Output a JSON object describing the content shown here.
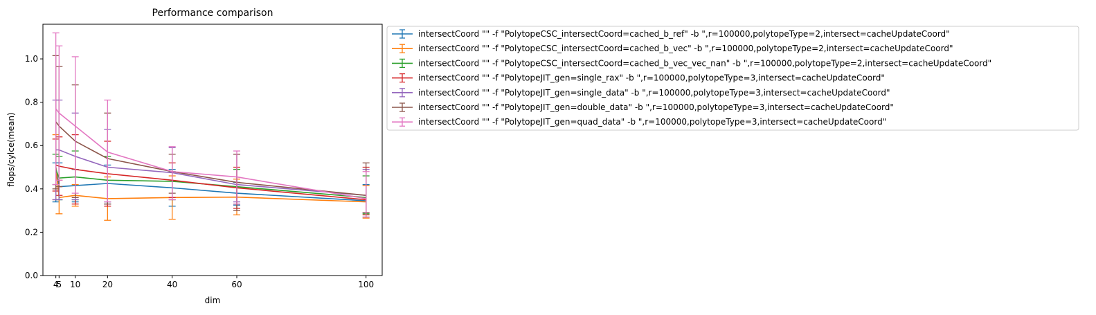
{
  "chart_data": {
    "type": "line",
    "title": "Performance comparison",
    "xlabel": "dim",
    "ylabel": "flops/cylce(mean)",
    "x": [
      4,
      5,
      10,
      20,
      40,
      60,
      100
    ],
    "xticks": [
      "4",
      "5",
      "10",
      "20",
      "40",
      "60",
      "100"
    ],
    "yticks": [
      "0.0",
      "0.2",
      "0.4",
      "0.6",
      "0.8",
      "1.0"
    ],
    "xlim": [
      0,
      105
    ],
    "ylim": [
      0,
      1.16
    ],
    "grid": false,
    "legend_position": "outside-right-top",
    "series": [
      {
        "name": "intersectCoord \"\" -f \"PolytopeCSC_intersectCoord=cached_b_ref\" -b \",r=100000,polytopeType=2,intersect=cacheUpdateCoord\"",
        "color": "#1f77b4",
        "values": [
          0.5,
          0.41,
          0.415,
          0.425,
          0.405,
          0.38,
          0.345
        ],
        "err_low": [
          0.34,
          0.35,
          0.34,
          0.34,
          0.32,
          0.325,
          0.27
        ],
        "err_high": [
          0.52,
          0.52,
          0.49,
          0.51,
          0.49,
          0.43,
          0.42
        ]
      },
      {
        "name": "intersectCoord \"\" -f \"PolytopeCSC_intersectCoord=cached_b_vec\" -b \",r=100000,polytopeType=2,intersect=cacheUpdateCoord\"",
        "color": "#ff7f0e",
        "values": [
          0.5,
          0.36,
          0.37,
          0.355,
          0.36,
          0.362,
          0.34
        ],
        "err_low": [
          0.35,
          0.285,
          0.32,
          0.255,
          0.26,
          0.28,
          0.265
        ],
        "err_high": [
          0.65,
          0.44,
          0.42,
          0.455,
          0.46,
          0.445,
          0.415
        ]
      },
      {
        "name": "intersectCoord \"\" -f \"PolytopeCSC_intersectCoord=cached_b_vec_vec_nan\" -b \",r=100000,polytopeType=2,intersect=cacheUpdateCoord\"",
        "color": "#2ca02c",
        "values": [
          0.49,
          0.45,
          0.455,
          0.44,
          0.435,
          0.41,
          0.36
        ],
        "err_low": [
          0.42,
          0.35,
          0.35,
          0.33,
          0.35,
          0.33,
          0.285
        ],
        "err_high": [
          0.56,
          0.55,
          0.575,
          0.55,
          0.48,
          0.49,
          0.46
        ]
      },
      {
        "name": "intersectCoord \"\" -f \"PolytopeJIT_gen=single_rax\" -b \",r=100000,polytopeType=3,intersect=cacheUpdateCoord\"",
        "color": "#d62728",
        "values": [
          0.51,
          0.505,
          0.49,
          0.47,
          0.44,
          0.405,
          0.35
        ],
        "err_low": [
          0.39,
          0.37,
          0.33,
          0.32,
          0.36,
          0.31,
          0.28
        ],
        "err_high": [
          0.63,
          0.64,
          0.65,
          0.62,
          0.52,
          0.5,
          0.5
        ]
      },
      {
        "name": "intersectCoord \"\" -f \"PolytopeJIT_gen=single_data\" -b \",r=100000,polytopeType=3,intersect=cacheUpdateCoord\"",
        "color": "#9467bd",
        "values": [
          0.58,
          0.58,
          0.55,
          0.5,
          0.475,
          0.42,
          0.37
        ],
        "err_low": [
          0.35,
          0.35,
          0.35,
          0.33,
          0.35,
          0.34,
          0.29
        ],
        "err_high": [
          0.81,
          0.81,
          0.75,
          0.675,
          0.59,
          0.56,
          0.49
        ]
      },
      {
        "name": "intersectCoord \"\" -f \"PolytopeJIT_gen=double_data\" -b \",r=100000,polytopeType=3,intersect=cacheUpdateCoord\"",
        "color": "#8c564b",
        "values": [
          0.71,
          0.69,
          0.62,
          0.54,
          0.48,
          0.43,
          0.37
        ],
        "err_low": [
          0.4,
          0.41,
          0.36,
          0.33,
          0.38,
          0.3,
          0.29
        ],
        "err_high": [
          1.015,
          0.965,
          0.88,
          0.75,
          0.56,
          0.56,
          0.52
        ]
      },
      {
        "name": "intersectCoord \"\" -f \"PolytopeJIT_gen=quad_data\" -b \",r=100000,polytopeType=3,intersect=cacheUpdateCoord\"",
        "color": "#e377c2",
        "values": [
          0.77,
          0.75,
          0.69,
          0.57,
          0.48,
          0.455,
          0.355
        ],
        "err_low": [
          0.42,
          0.44,
          0.38,
          0.34,
          0.35,
          0.33,
          0.27
        ],
        "err_high": [
          1.12,
          1.06,
          1.01,
          0.81,
          0.595,
          0.575,
          0.48
        ]
      }
    ]
  }
}
